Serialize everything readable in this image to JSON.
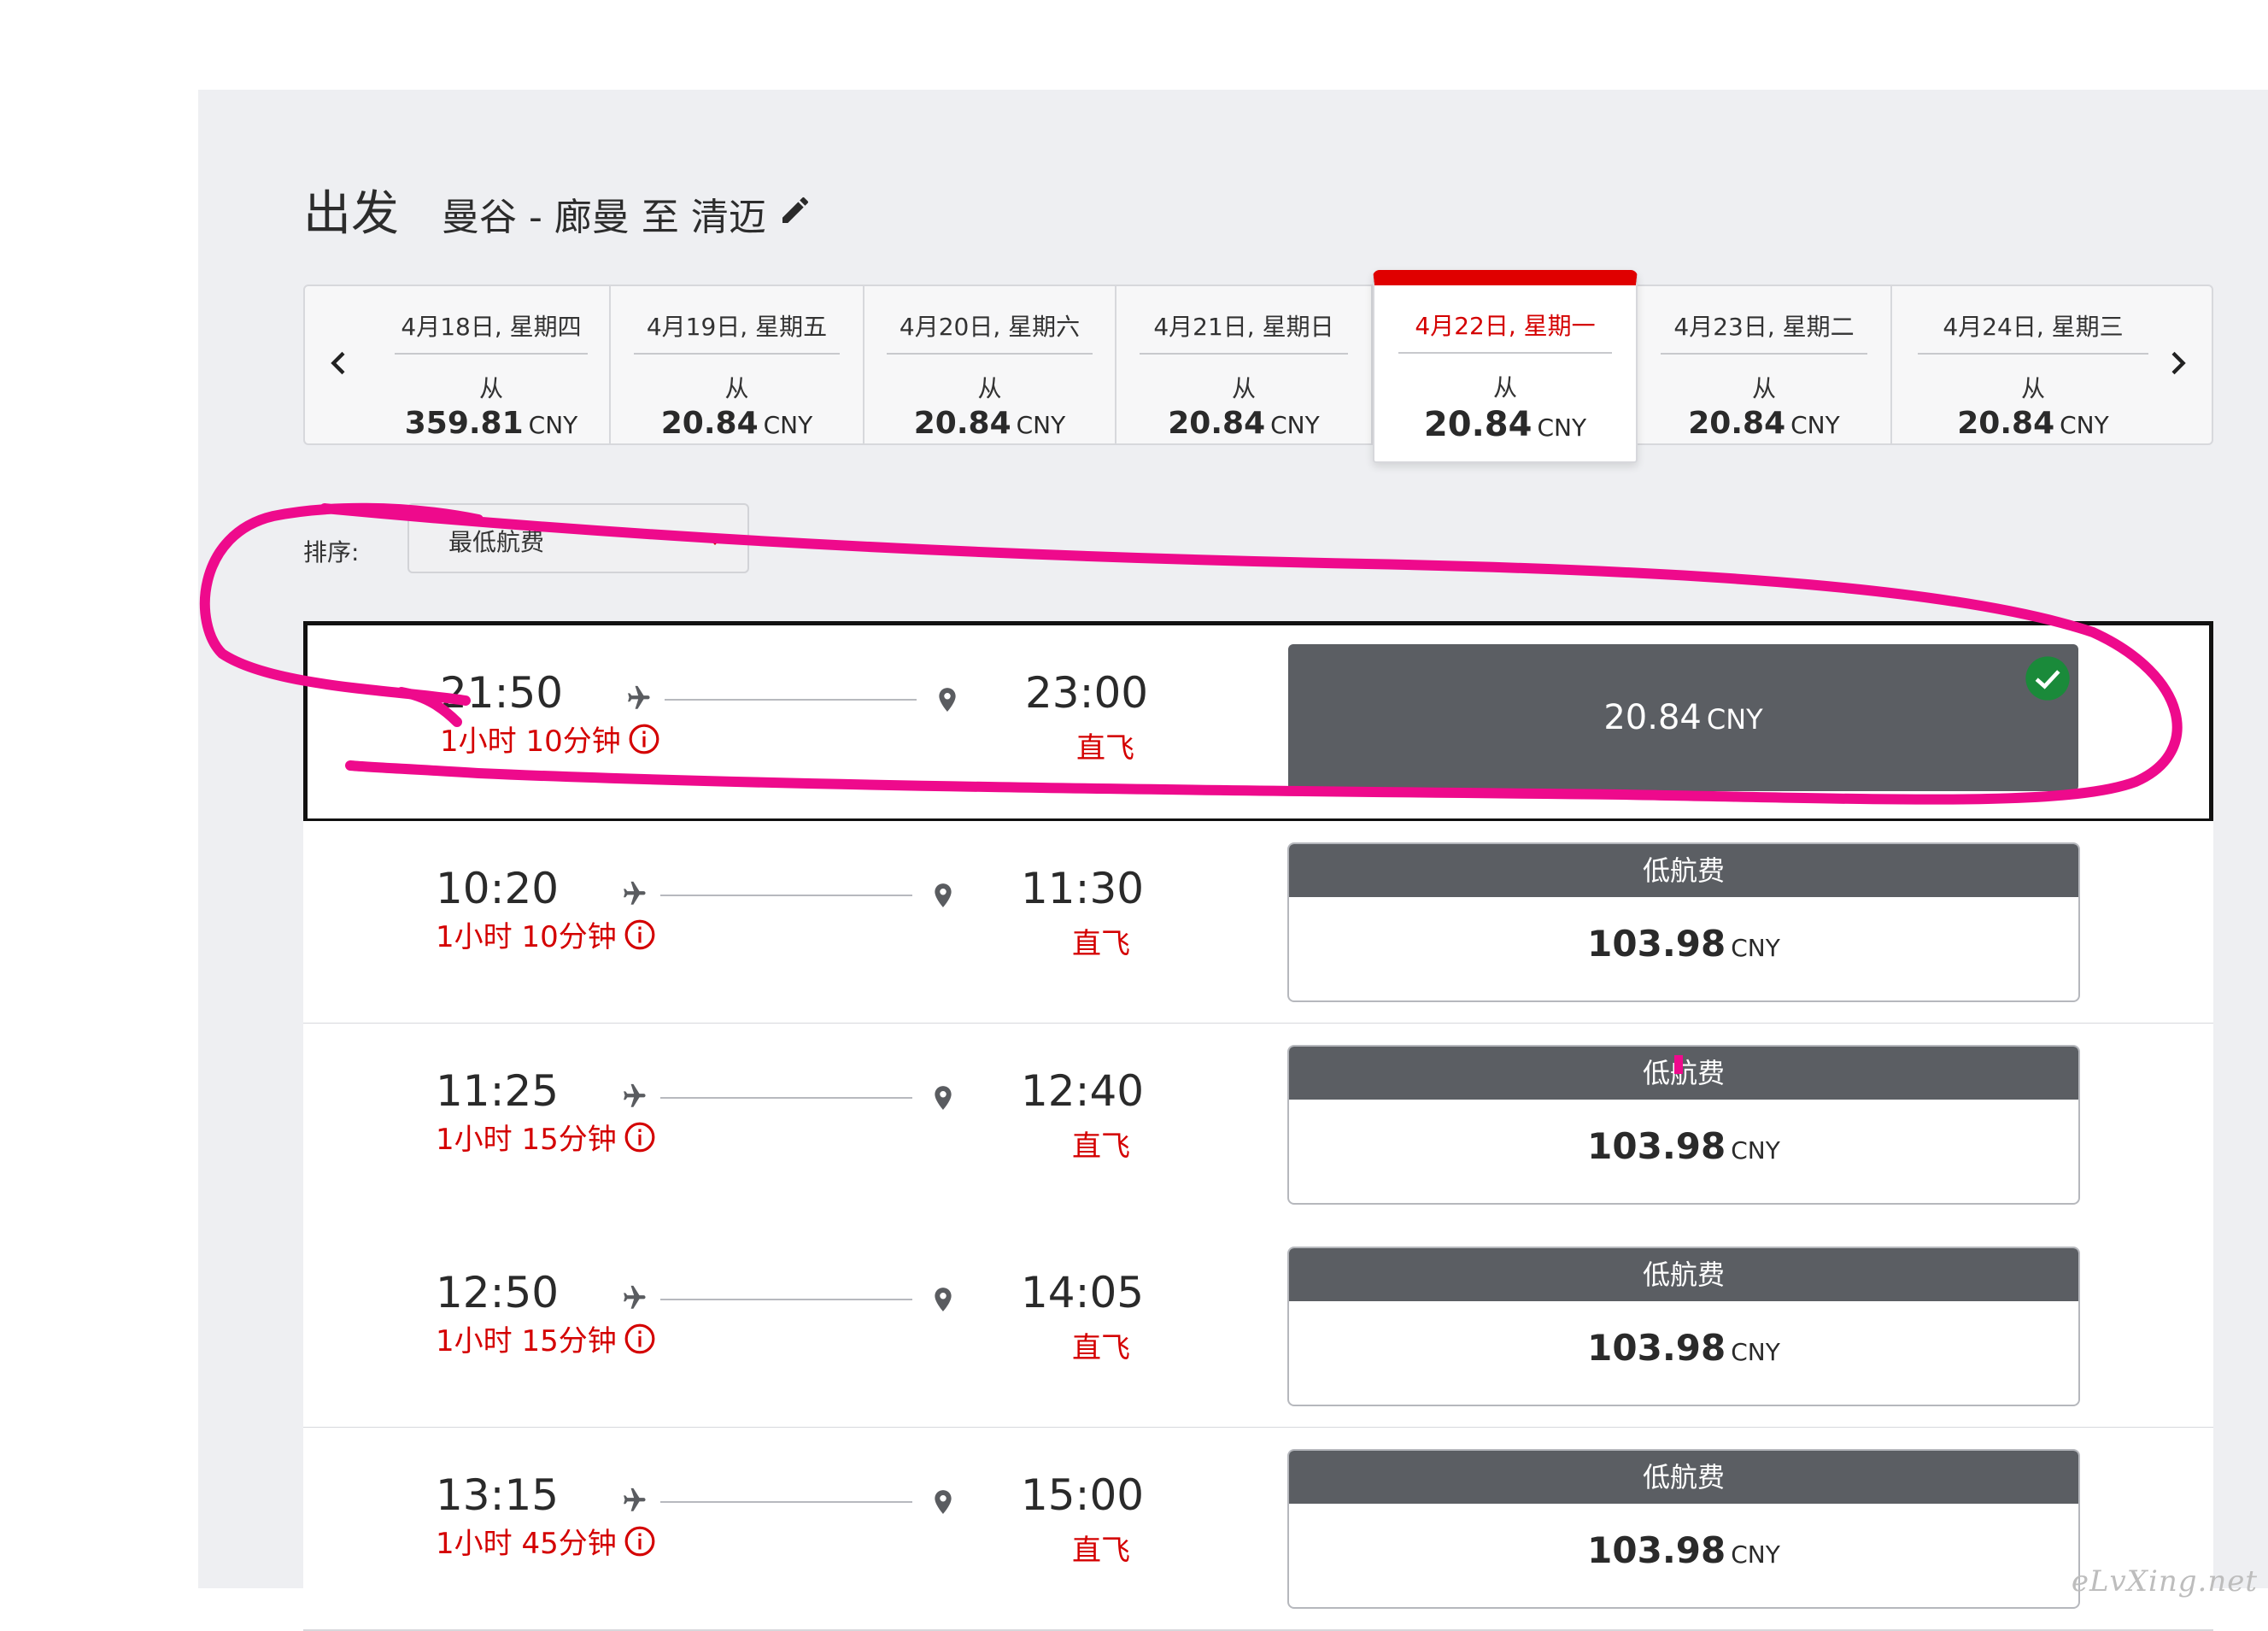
{
  "header": {
    "direction": "出发",
    "route": "曼谷 - 廊曼 至 清迈"
  },
  "dates": [
    {
      "label": "4月18日, 星期四",
      "from": "从",
      "price": "359.81",
      "currency": "CNY"
    },
    {
      "label": "4月19日, 星期五",
      "from": "从",
      "price": "20.84",
      "currency": "CNY"
    },
    {
      "label": "4月20日, 星期六",
      "from": "从",
      "price": "20.84",
      "currency": "CNY"
    },
    {
      "label": "4月21日, 星期日",
      "from": "从",
      "price": "20.84",
      "currency": "CNY"
    },
    {
      "label": "4月22日, 星期一",
      "from": "从",
      "price": "20.84",
      "currency": "CNY",
      "active": true
    },
    {
      "label": "4月23日, 星期二",
      "from": "从",
      "price": "20.84",
      "currency": "CNY"
    },
    {
      "label": "4月24日, 星期三",
      "from": "从",
      "price": "20.84",
      "currency": "CNY"
    }
  ],
  "sort": {
    "label": "排序:",
    "value": "最低航费"
  },
  "flights": [
    {
      "dep": "21:50",
      "arr": "23:00",
      "duration": "1小时 10分钟",
      "stops": "直飞",
      "tag": "",
      "price": "20.84",
      "currency": "CNY",
      "selected": true
    },
    {
      "dep": "10:20",
      "arr": "11:30",
      "duration": "1小时 10分钟",
      "stops": "直飞",
      "tag": "低航费",
      "price": "103.98",
      "currency": "CNY"
    },
    {
      "dep": "11:25",
      "arr": "12:40",
      "duration": "1小时 15分钟",
      "stops": "直飞",
      "tag": "低航费",
      "price": "103.98",
      "currency": "CNY"
    },
    {
      "dep": "12:50",
      "arr": "14:05",
      "duration": "1小时 15分钟",
      "stops": "直飞",
      "tag": "低航费",
      "price": "103.98",
      "currency": "CNY"
    },
    {
      "dep": "13:15",
      "arr": "15:00",
      "duration": "1小时 45分钟",
      "stops": "直飞",
      "tag": "低航费",
      "price": "103.98",
      "currency": "CNY"
    }
  ],
  "watermark": "eLvXing.net",
  "colors": {
    "accent": "#d40000",
    "panel": "#eeeff2",
    "price_dark": "#5b5e63",
    "check": "#1a8a3a",
    "annotation": "#ee0a8c"
  },
  "icons": {
    "edit": "pencil-icon",
    "prev": "chevron-left-icon",
    "next": "chevron-right-icon",
    "plane": "plane-icon",
    "pin": "location-pin-icon",
    "info": "info-icon",
    "check": "check-circle-icon",
    "caret": "caret-down-icon"
  }
}
